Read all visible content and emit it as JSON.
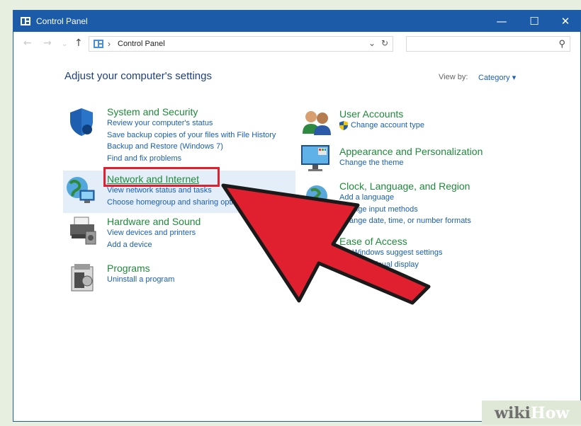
{
  "window": {
    "title": "Control Panel",
    "buttons": {
      "minimize": "—",
      "maximize": "☐",
      "close": "✕"
    }
  },
  "address": {
    "back": "←",
    "forward": "→",
    "up": "↑",
    "separator": "›",
    "breadcrumb": "Control Panel",
    "dropdown": "⌄",
    "refresh": "↻",
    "search_placeholder": "",
    "search_icon": "⚲"
  },
  "main": {
    "heading": "Adjust your computer's settings",
    "view_by_label": "View by:",
    "view_by_value": "Category ▾",
    "left_categories": [
      {
        "icon": "shield-icon",
        "title": "System and Security",
        "links": [
          "Review your computer's status",
          "Save backup copies of your files with File History",
          "Backup and Restore (Windows 7)",
          "Find and fix problems"
        ]
      },
      {
        "icon": "network-icon",
        "title": "Network and Internet",
        "links": [
          "View network status and tasks",
          "Choose homegroup and sharing options"
        ]
      },
      {
        "icon": "printer-icon",
        "title": "Hardware and Sound",
        "links": [
          "View devices and printers",
          "Add a device"
        ]
      },
      {
        "icon": "programs-icon",
        "title": "Programs",
        "links": [
          "Uninstall a program"
        ]
      }
    ],
    "right_categories": [
      {
        "icon": "users-icon",
        "title": "User Accounts",
        "links": [
          "Change account type"
        ]
      },
      {
        "icon": "monitor-icon",
        "title": "Appearance and Personalization",
        "links": [
          "Change the theme"
        ]
      },
      {
        "icon": "globe-icon",
        "title": "Clock, Language, and Region",
        "links": [
          "Add a language",
          "Change input methods",
          "Change date, time, or number formats"
        ]
      },
      {
        "icon": "accessibility-icon",
        "title": "Ease of Access",
        "links": [
          "Let Windows suggest settings",
          "Optimize visual display"
        ]
      }
    ]
  },
  "annotation": {
    "color": "#e1202f"
  },
  "watermark": {
    "wiki": "wiki",
    "how": "How"
  },
  "colors": {
    "titlebar": "#1b5ba8",
    "category_title": "#1e8a3a",
    "link": "#1a5fb4",
    "heading": "#1e3f7d",
    "highlight": "#e4eef9"
  }
}
